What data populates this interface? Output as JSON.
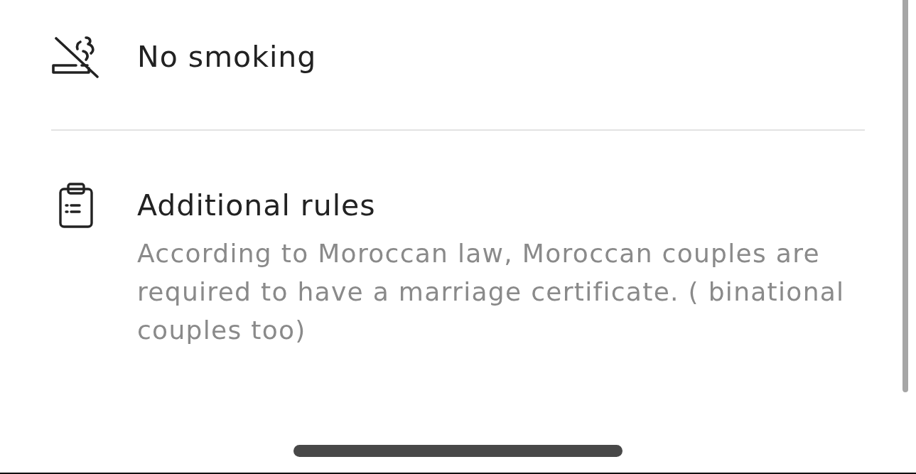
{
  "rules": [
    {
      "kind": "no-smoking",
      "title": "No smoking"
    },
    {
      "kind": "clipboard",
      "title": "Additional rules",
      "description": "According to Moroccan law, Moroccan couples are required to have a marriage certificate. ( binational couples too)"
    }
  ]
}
